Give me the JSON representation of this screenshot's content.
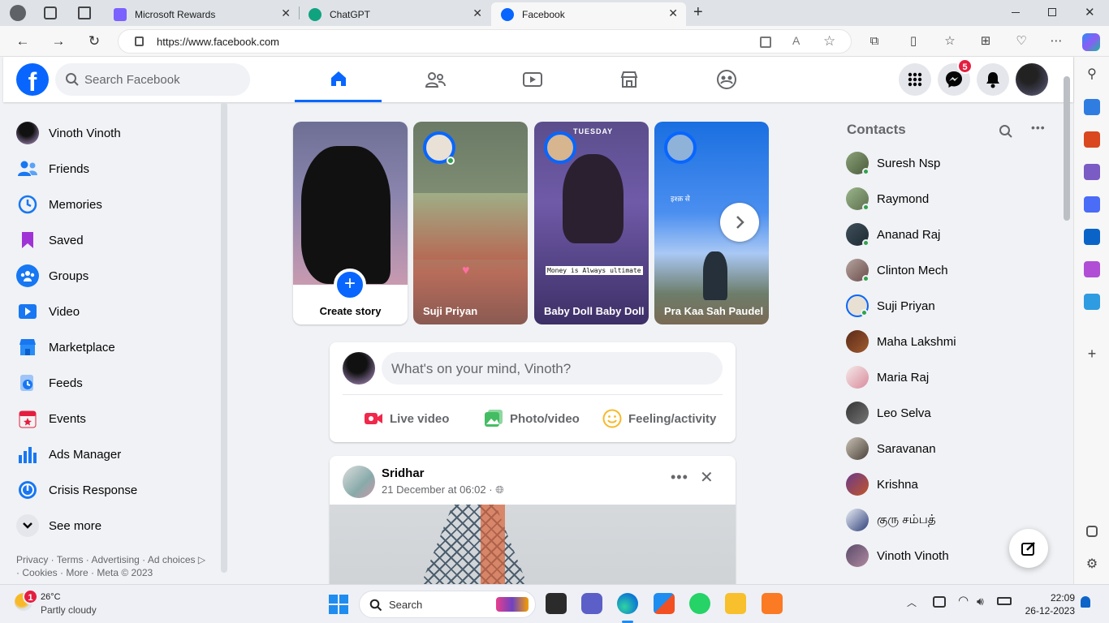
{
  "browser": {
    "tabs": [
      {
        "title": "Microsoft Rewards",
        "active": false
      },
      {
        "title": "ChatGPT",
        "active": false
      },
      {
        "title": "Facebook",
        "active": true
      }
    ],
    "url": "https://www.facebook.com"
  },
  "header": {
    "search_placeholder": "Search Facebook",
    "messenger_badge": "5"
  },
  "left_nav": {
    "items": [
      {
        "label": "Vinoth Vinoth",
        "icon": "profile-avatar"
      },
      {
        "label": "Friends",
        "icon": "friends-icon"
      },
      {
        "label": "Memories",
        "icon": "clock-icon"
      },
      {
        "label": "Saved",
        "icon": "bookmark-icon"
      },
      {
        "label": "Groups",
        "icon": "groups-icon"
      },
      {
        "label": "Video",
        "icon": "video-icon"
      },
      {
        "label": "Marketplace",
        "icon": "marketplace-icon"
      },
      {
        "label": "Feeds",
        "icon": "feeds-icon"
      },
      {
        "label": "Events",
        "icon": "calendar-icon"
      },
      {
        "label": "Ads Manager",
        "icon": "chart-icon"
      },
      {
        "label": "Crisis Response",
        "icon": "crisis-icon"
      },
      {
        "label": "See more",
        "icon": "chevron-down-icon"
      }
    ],
    "footer_line1": "Privacy · Terms · Advertising · Ad choices ",
    "footer_line2": "· Cookies · More · Meta © 2023"
  },
  "stories": [
    {
      "name": "Create story"
    },
    {
      "name": "Suji Priyan"
    },
    {
      "name": "Baby Doll Baby Doll",
      "overlay_top": "TUESDAY",
      "overlay_text": "Money is Always ultimate"
    },
    {
      "name": "Pra Kaa Sah Paudel",
      "overlay_text": "इश्क़ से"
    }
  ],
  "composer": {
    "placeholder": "What's on your mind, Vinoth?",
    "live_label": "Live video",
    "photo_label": "Photo/video",
    "feeling_label": "Feeling/activity"
  },
  "post": {
    "author": "Sridhar",
    "timestamp": "21 December at 06:02 · "
  },
  "contacts": {
    "title": "Contacts",
    "list": [
      {
        "name": "Suresh Nsp",
        "online": true
      },
      {
        "name": "Raymond",
        "online": true
      },
      {
        "name": "Ananad Raj",
        "online": true
      },
      {
        "name": "Clinton Mech",
        "online": true
      },
      {
        "name": "Suji Priyan",
        "online": true
      },
      {
        "name": "Maha Lakshmi",
        "online": false
      },
      {
        "name": "Maria Raj",
        "online": false
      },
      {
        "name": "Leo Selva",
        "online": false
      },
      {
        "name": "Saravanan",
        "online": false
      },
      {
        "name": "Krishna",
        "online": false
      },
      {
        "name": "குரு சம்பத்",
        "online": false
      },
      {
        "name": "Vinoth Vinoth",
        "online": false
      }
    ]
  },
  "taskbar": {
    "weather_temp": "26°C",
    "weather_desc": "Partly cloudy",
    "weather_badge": "1",
    "search_label": "Search",
    "time": "22:09",
    "date": "26-12-2023"
  },
  "colors": {
    "brand": "#0866ff",
    "badge": "#e41e3f",
    "online": "#31a24c"
  }
}
